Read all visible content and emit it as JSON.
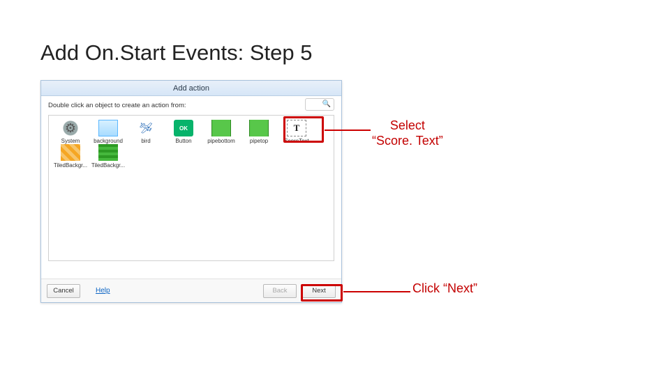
{
  "slide": {
    "title": "Add On.Start Events: Step 5"
  },
  "annotations": {
    "select_line1": "Select",
    "select_line2": "“Score. Text”",
    "click_next": "Click “Next”"
  },
  "dialog": {
    "title": "Add action",
    "prompt": "Double click an object to create an action from:",
    "search_placeholder": "",
    "objects": [
      {
        "name": "System",
        "icon": "system"
      },
      {
        "name": "background",
        "icon": "background"
      },
      {
        "name": "bird",
        "icon": "bird"
      },
      {
        "name": "Button",
        "icon": "button",
        "glyph": "OK"
      },
      {
        "name": "pipebottom",
        "icon": "pipebottom"
      },
      {
        "name": "pipetop",
        "icon": "pipetop"
      },
      {
        "name": "ScoreText",
        "icon": "scoretext",
        "glyph": "T"
      },
      {
        "name": "TiledBackgr...",
        "icon": "tilebg1"
      },
      {
        "name": "TiledBackgr...",
        "icon": "tilebg2"
      }
    ],
    "footer": {
      "cancel": "Cancel",
      "help": "Help",
      "back": "Back",
      "next": "Next"
    }
  }
}
